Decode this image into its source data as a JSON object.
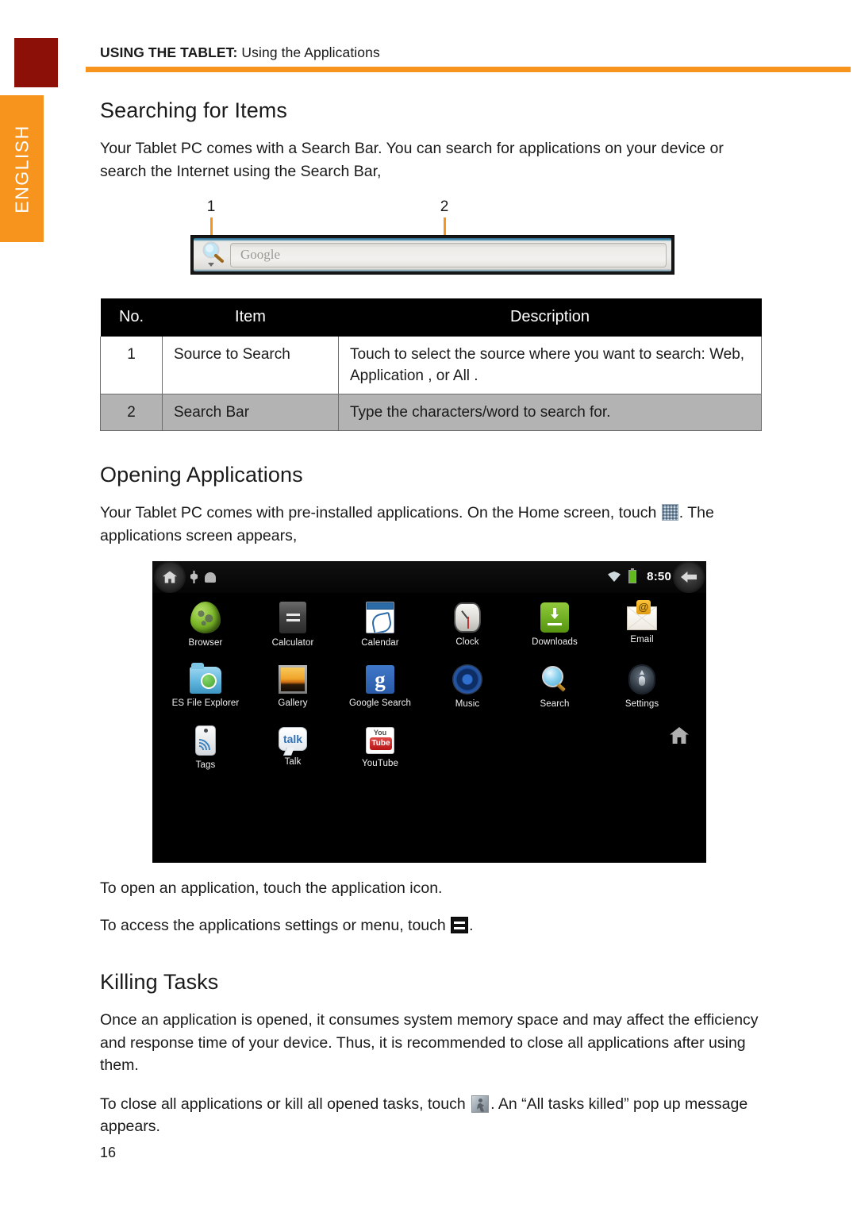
{
  "header": {
    "breadcrumb_main": "USING THE TABLET:",
    "breadcrumb_sub": " Using the Applications"
  },
  "sidebar": {
    "language_label": "ENGLISH",
    "accent_color": "#F7941E",
    "corner_color": "#8C1008"
  },
  "sections": {
    "searching": {
      "heading": "Searching for Items",
      "intro": "Your Tablet PC comes with a Search Bar. You can search for applications on your device or search the Internet using the Search Bar,"
    },
    "opening": {
      "heading": "Opening Applications",
      "intro_before_icon": "Your Tablet PC comes with pre-installed applications. On the Home screen, touch ",
      "intro_after_icon": ". The applications screen appears,",
      "open_app_line": "To open an application, touch the application icon.",
      "menu_line_before_icon": "To access the applications settings or menu, touch ",
      "menu_line_after_icon": "."
    },
    "killing": {
      "heading": "Killing Tasks",
      "paragraph": "Once an application is opened, it consumes system memory space and may affect the efficiency and response time of your device. Thus, it is recommended to close all applications after using them.",
      "close_line_before_icon": "To close all applications or kill all opened tasks, touch ",
      "close_line_after_icon": ". An “All tasks killed” pop up message appears."
    }
  },
  "search_figure": {
    "callout_1": "1",
    "callout_2": "2",
    "placeholder": "Google"
  },
  "spec_table": {
    "columns": [
      "No.",
      "Item",
      "Description"
    ],
    "rows": [
      {
        "no": "1",
        "item": "Source to Search",
        "description": "Touch to select the source where you want to search: Web, Application , or All ."
      },
      {
        "no": "2",
        "item": "Search Bar",
        "description": "Type the characters/word to search for."
      }
    ]
  },
  "tablet": {
    "status": {
      "time": "8:50"
    },
    "apps": [
      [
        {
          "label": "Browser",
          "icon": "browser-icon"
        },
        {
          "label": "Calculator",
          "icon": "calculator-icon"
        },
        {
          "label": "Calendar",
          "icon": "calendar-icon"
        },
        {
          "label": "Clock",
          "icon": "clock-icon"
        },
        {
          "label": "Downloads",
          "icon": "downloads-icon"
        },
        {
          "label": "Email",
          "icon": "email-icon"
        }
      ],
      [
        {
          "label": "ES File Explorer",
          "icon": "es-file-explorer-icon"
        },
        {
          "label": "Gallery",
          "icon": "gallery-icon"
        },
        {
          "label": "Google Search",
          "icon": "google-search-icon"
        },
        {
          "label": "Music",
          "icon": "music-icon"
        },
        {
          "label": "Search",
          "icon": "search-icon"
        },
        {
          "label": "Settings",
          "icon": "settings-icon"
        }
      ],
      [
        {
          "label": "Tags",
          "icon": "tags-icon"
        },
        {
          "label": "Talk",
          "icon": "talk-icon"
        },
        {
          "label": "YouTube",
          "icon": "youtube-icon"
        }
      ]
    ],
    "google_search_glyph": "g",
    "talk_glyph": "talk"
  },
  "footer": {
    "page_number": "16"
  }
}
